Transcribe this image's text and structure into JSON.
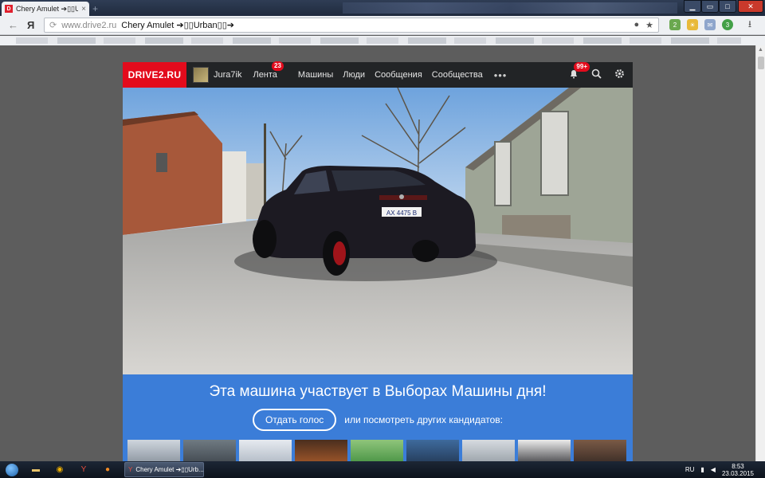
{
  "browser": {
    "tab_title": "Chery Amulet ➔▯▯Urba",
    "tab_favicon": "D",
    "close_glyph": "×",
    "url_host": "www.drive2.ru",
    "page_title": "Chery Amulet ➔▯▯Urban▯▯➔",
    "back": "←",
    "ya": "Я",
    "ext_badges": [
      "2",
      "3"
    ]
  },
  "site": {
    "logo": "DRIVE2.RU",
    "user": "Jura7ik",
    "nav": [
      "Лента",
      "Машины",
      "Люди",
      "Сообщения",
      "Сообщества"
    ],
    "feed_badge": "23",
    "notif_badge": "99+",
    "more": "•••",
    "plate": "AX 4475 B",
    "vote_title": "Эта машина участвует в Выборах Машины дня!",
    "vote_button": "Отдать голос",
    "vote_other": "или посмотреть других кандидатов:"
  },
  "taskbar": {
    "task_title": "Chery Amulet ➔▯▯Urb...",
    "lang": "RU",
    "time": "8:53",
    "date": "23.03.2015"
  },
  "colors": {
    "brand": "#e30b1c",
    "vote_bg": "#3b7dd8",
    "site_header": "#222426"
  }
}
